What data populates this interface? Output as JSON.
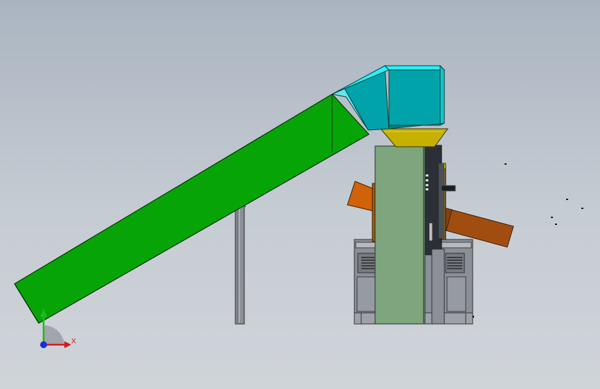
{
  "colors": {
    "background_top": "#aab4c0",
    "background_bottom": "#cfd4d9",
    "conveyor_green": "#06a406",
    "hood_cyan": "#00a3a9",
    "hood_cyan_light": "#26f2f7",
    "hopper_yellow": "#c7b100",
    "panel_green": "#7ea57d",
    "chute_orange": "#d06208",
    "chute_brown": "#a24d10",
    "frame_gray": "#8b8f96"
  },
  "triad": {
    "y_label": "Y",
    "x_label": "X",
    "y_color": "#1dbb1d",
    "x_color": "#d21a1a",
    "origin_color": "#1a2fd4"
  }
}
